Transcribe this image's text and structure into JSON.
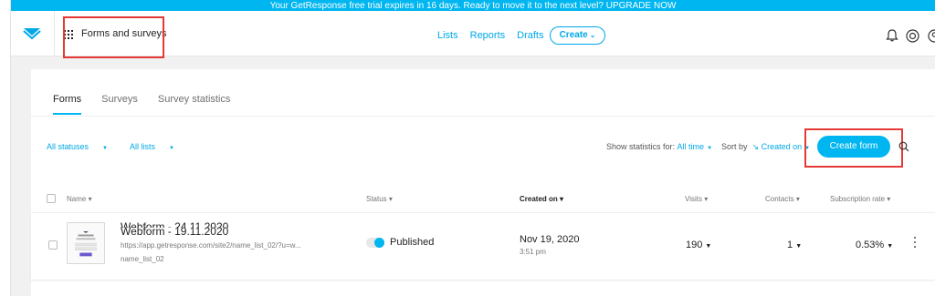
{
  "banner": {
    "text": "Your GetResponse free trial expires in 16 days. Ready to move it to the next level? UPGRADE NOW"
  },
  "header": {
    "app_title": "Forms and surveys",
    "nav": [
      "Lists",
      "Reports",
      "Drafts"
    ],
    "create_label": "Create",
    "icons": [
      "logo-icon",
      "apps-grid-icon",
      "bell-icon",
      "help-icon",
      "user-icon"
    ]
  },
  "tabs": [
    "Forms",
    "Surveys",
    "Survey statistics"
  ],
  "filters": {
    "status": "All statuses",
    "lists": "All lists"
  },
  "stats": {
    "label": "Show statistics for:",
    "period": "All time",
    "sort_label": "Sort by",
    "sort_value": "Created on"
  },
  "create_form_label": "Create form",
  "table": {
    "headers": {
      "name": "Name",
      "status": "Status",
      "created": "Created on",
      "visits": "Visits",
      "contacts": "Contacts",
      "rate": "Subscription rate"
    },
    "rows": [
      {
        "title": "Webform - 19.11.2020",
        "url": "https://app.getresponse.com/site2/name_list_02/?u=w...",
        "list": "name_list_02",
        "status": "Published",
        "date": "Nov 19, 2020",
        "time": "3:51 pm",
        "visits": "190",
        "contacts": "1",
        "rate": "0.53%"
      },
      {
        "title": "Webform - 24.11.2020"
      }
    ]
  },
  "colors": {
    "accent": "#00b6f0",
    "highlight": "#e53935"
  }
}
